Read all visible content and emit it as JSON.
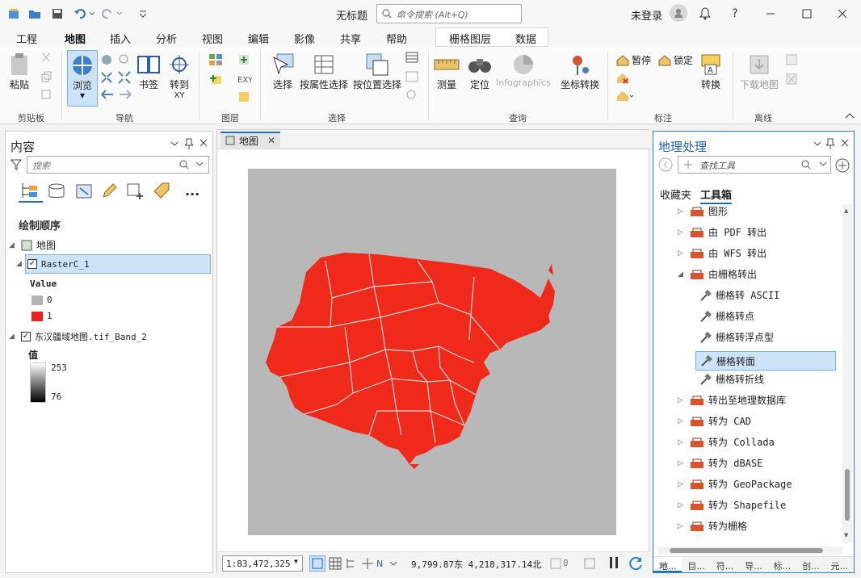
{
  "title_bar": {
    "doc_title": "无标题",
    "search_placeholder": "命令搜索 (Alt+Q)",
    "signin": "未登录"
  },
  "tabs": [
    {
      "label": "工程"
    },
    {
      "label": "地图",
      "active": true
    },
    {
      "label": "插入"
    },
    {
      "label": "分析"
    },
    {
      "label": "视图"
    },
    {
      "label": "编辑"
    },
    {
      "label": "影像"
    },
    {
      "label": "共享"
    },
    {
      "label": "帮助"
    }
  ],
  "context_tabs": [
    {
      "label": "栅格图层"
    },
    {
      "label": "数据"
    }
  ],
  "ribbon": {
    "paste": "粘贴",
    "group_clipboard": "剪贴板",
    "browse": "浏览",
    "bookmark": "书签",
    "goto": "转到",
    "goto_sub": "XY",
    "group_nav": "导航",
    "group_layer": "图层",
    "select": "选择",
    "select_by_attr": "按属性选择",
    "select_by_loc": "按位置选择",
    "group_select": "选择",
    "measure": "测量",
    "locate": "定位",
    "infographics": "Infographics",
    "coord_convert": "坐标转换",
    "group_query": "查询",
    "pause": "暂停",
    "lock": "锁定",
    "convert": "转换",
    "group_label": "标注",
    "download_map": "下载地图",
    "group_offline": "离线"
  },
  "contents": {
    "title": "内容",
    "search_placeholder": "搜索",
    "section": "绘制顺序",
    "map": "地图",
    "layer1": "RasterC_1",
    "value_header": "Value",
    "legend": [
      {
        "label": "0",
        "color": "#b3b3b3"
      },
      {
        "label": "1",
        "color": "#e8231a"
      }
    ],
    "layer2": "东汉疆域地图.tif_Band_2",
    "value_label": "值",
    "ramp_max": "253",
    "ramp_min": "76"
  },
  "map_view": {
    "tab": "地图",
    "scale": "1:83,472,325",
    "coords": "9,799.87东 4,218,317.14北",
    "sel_count": "0",
    "bg_color": "#b8b8b8",
    "fill_color": "#ef2a1b"
  },
  "geoprocessing": {
    "title": "地理处理",
    "search_placeholder": "查找工具",
    "tab_favorites": "收藏夹",
    "tab_toolbox": "工具箱",
    "tree": [
      {
        "label": "图形",
        "level": 0,
        "type": "set"
      },
      {
        "label": "由 PDF 转出",
        "level": 0,
        "type": "set"
      },
      {
        "label": "由 WFS 转出",
        "level": 0,
        "type": "set"
      },
      {
        "label": "由栅格转出",
        "level": 0,
        "type": "set",
        "open": true
      },
      {
        "label": "栅格转 ASCII",
        "level": 1,
        "type": "tool"
      },
      {
        "label": "栅格转点",
        "level": 1,
        "type": "tool"
      },
      {
        "label": "栅格转浮点型",
        "level": 1,
        "type": "tool"
      },
      {
        "label": "栅格转面",
        "level": 1,
        "type": "tool",
        "selected": true
      },
      {
        "label": "栅格转折线",
        "level": 1,
        "type": "tool"
      },
      {
        "label": "转出至地理数据库",
        "level": 0,
        "type": "set"
      },
      {
        "label": "转为 CAD",
        "level": 0,
        "type": "set"
      },
      {
        "label": "转为 Collada",
        "level": 0,
        "type": "set"
      },
      {
        "label": "转为 dBASE",
        "level": 0,
        "type": "set"
      },
      {
        "label": "转为 GeoPackage",
        "level": 0,
        "type": "set"
      },
      {
        "label": "转为 Shapefile",
        "level": 0,
        "type": "set"
      },
      {
        "label": "转为栅格",
        "level": 0,
        "type": "set"
      }
    ],
    "bottom_tabs": [
      {
        "label": "地..."
      },
      {
        "label": "目..."
      },
      {
        "label": "符..."
      },
      {
        "label": "导..."
      },
      {
        "label": "标..."
      },
      {
        "label": "创..."
      },
      {
        "label": "元..."
      }
    ]
  }
}
